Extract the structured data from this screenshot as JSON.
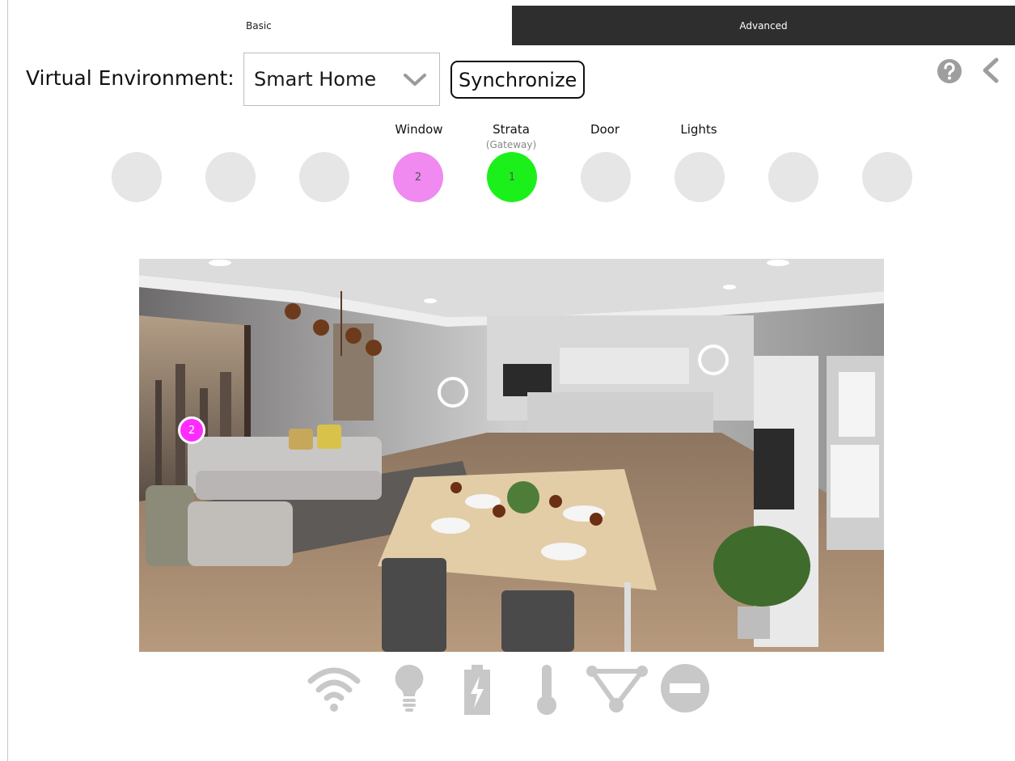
{
  "tabs": {
    "basic": "Basic",
    "advanced": "Advanced"
  },
  "header": {
    "environment_label": "Virtual Environment:",
    "environment_value": "Smart Home",
    "sync_label": "Synchronize"
  },
  "nodes": [
    {
      "label": "",
      "sub": "",
      "number": "",
      "color": "#e6e6e6"
    },
    {
      "label": "",
      "sub": "",
      "number": "",
      "color": "#e6e6e6"
    },
    {
      "label": "",
      "sub": "",
      "number": "",
      "color": "#e6e6e6"
    },
    {
      "label": "Window",
      "sub": "",
      "number": "2",
      "color": "#f089f0"
    },
    {
      "label": "Strata",
      "sub": "(Gateway)",
      "number": "1",
      "color": "#1bf01b"
    },
    {
      "label": "Door",
      "sub": "",
      "number": "",
      "color": "#e6e6e6"
    },
    {
      "label": "Lights",
      "sub": "",
      "number": "",
      "color": "#e6e6e6"
    },
    {
      "label": "",
      "sub": "",
      "number": "",
      "color": "#e6e6e6"
    },
    {
      "label": "",
      "sub": "",
      "number": "",
      "color": "#e6e6e6"
    }
  ],
  "scene": {
    "markers": [
      {
        "type": "node",
        "number": "2"
      },
      {
        "type": "ring",
        "number": ""
      },
      {
        "type": "ring",
        "number": ""
      }
    ]
  },
  "toolbar": {
    "icons": [
      "wifi-icon",
      "lightbulb-icon",
      "battery-icon",
      "thermometer-icon",
      "mesh-icon",
      "remove-icon"
    ],
    "icon_color": "#c8c8c8"
  },
  "colors": {
    "advanced_tab": "#2e2e2e",
    "node_idle": "#e6e6e6",
    "window_node": "#f089f0",
    "gateway_node": "#1bf01b",
    "marker_pink": "#ff2bff"
  }
}
